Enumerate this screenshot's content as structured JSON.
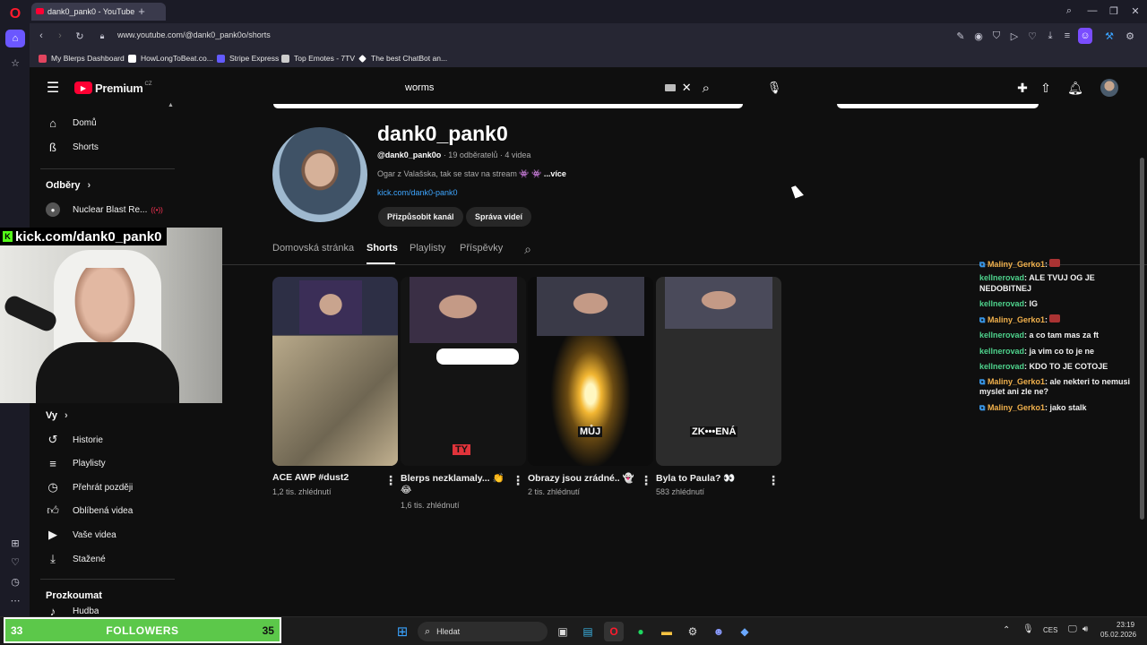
{
  "browser": {
    "tab_title": "dank0_pank0 - YouTube",
    "url": "www.youtube.com/@dank0_pank0o/shorts",
    "bookmarks": [
      "My Blerps Dashboard",
      "HowLongToBeat.co...",
      "Stripe Express",
      "Top Emotes - 7TV",
      "The best ChatBot an..."
    ]
  },
  "youtube": {
    "logo": "Premium",
    "region": "CZ",
    "search_value": "worms",
    "nav": {
      "home": "Domů",
      "shorts": "Shorts",
      "subs_header": "Odběry",
      "sub_channel": "Nuclear Blast Re...",
      "you_header": "Vy",
      "history": "Historie",
      "playlists": "Playlisty",
      "watch_later": "Přehrát později",
      "liked": "Oblíbená videa",
      "your_videos": "Vaše videa",
      "downloads": "Stažené",
      "explore": "Prozkoumat",
      "music": "Hudba"
    },
    "channel": {
      "name": "dank0_pank0",
      "handle": "@dank0_pank0o",
      "stats": " · 19 odběratelů · 4 videa",
      "description": "Ogar z Valašska, tak se stav na stream 👾 👾",
      "more": "...více",
      "link": "kick.com/dank0-pank0",
      "customize_btn": "Přizpůsobit kanál",
      "manage_btn": "Správa videí"
    },
    "tabs": [
      "Domovská stránka",
      "Shorts",
      "Playlisty",
      "Příspěvky"
    ],
    "shorts": [
      {
        "title": "ACE AWP #dust2",
        "views": "1,2 tis. zhlédnutí",
        "overlay": ""
      },
      {
        "title": "Blerps nezklamaly... 👏",
        "title2": "😂",
        "views": "1,6 tis. zhlédnutí",
        "overlay": "TY"
      },
      {
        "title": "Obrazy jsou zrádné.. 👻",
        "views": "2 tis. zhlédnutí",
        "overlay": "MŮJ"
      },
      {
        "title": "Byla to Paula? 👀",
        "views": "583 zhlédnutí",
        "overlay": "ZK•••ENÁ"
      }
    ]
  },
  "stream": {
    "webcam_label": "kick.com/dank0_pank0",
    "followers_left": "33",
    "followers_label": "FOLLOWERS",
    "followers_right": "35",
    "chat": [
      {
        "user": "Maliny_Gerko1",
        "msg": ":",
        "color": "#f0b04c"
      },
      {
        "user": "kellnerovad",
        "msg": ": ALE TVUJ OG JE NEDOBITNEJ",
        "color": "#4ed28c"
      },
      {
        "user": "kellnerovad",
        "msg": ": IG",
        "color": "#4ed28c"
      },
      {
        "user": "Maliny_Gerko1",
        "msg": ":",
        "color": "#f0b04c"
      },
      {
        "user": "kellnerovad",
        "msg": ": a co tam mas za ft",
        "color": "#4ed28c"
      },
      {
        "user": "kellnerovad",
        "msg": ": ja vim co to je ne",
        "color": "#4ed28c"
      },
      {
        "user": "kellnerovad",
        "msg": ": KDO TO JE COTOJE",
        "color": "#4ed28c"
      },
      {
        "user": "Maliny_Gerko1",
        "msg": ": ale nekteri to nemusi myslet ani zle ne?",
        "color": "#f0b04c"
      },
      {
        "user": "Maliny_Gerko1",
        "msg": ": jako stalk",
        "color": "#f0b04c"
      }
    ]
  },
  "taskbar": {
    "search": "Hledat",
    "lang": "CES",
    "time": "23:19",
    "date": "05.02.2026"
  },
  "colors": {
    "accent_red": "#ff0033",
    "kick_green": "#53fc18",
    "followers_green": "#5cc84a"
  }
}
